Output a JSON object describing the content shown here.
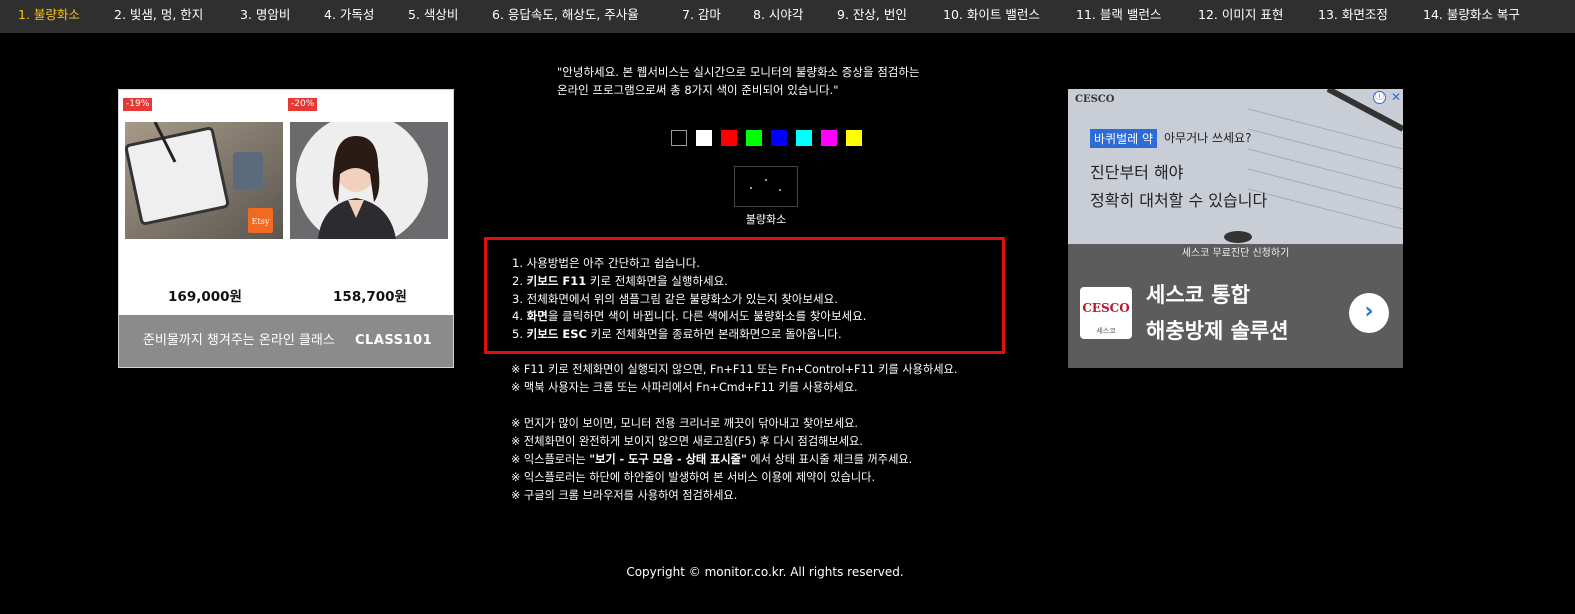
{
  "nav": {
    "items": [
      {
        "label": "1. 불량화소",
        "active": true
      },
      {
        "label": "2. 빛샘, 멍, 한지",
        "active": false
      },
      {
        "label": "3. 명암비",
        "active": false
      },
      {
        "label": "4. 가독성",
        "active": false
      },
      {
        "label": "5. 색상비",
        "active": false
      },
      {
        "label": "6. 응답속도, 해상도, 주사율",
        "active": false
      },
      {
        "label": "7. 감마",
        "active": false
      },
      {
        "label": "8. 시야각",
        "active": false
      },
      {
        "label": "9. 잔상, 번인",
        "active": false
      },
      {
        "label": "10. 화이트 밸런스",
        "active": false
      },
      {
        "label": "11. 블랙 밸런스",
        "active": false
      },
      {
        "label": "12. 이미지 표현",
        "active": false
      },
      {
        "label": "13. 화면조정",
        "active": false
      },
      {
        "label": "14. 불량화소 복구",
        "active": false
      }
    ],
    "active_color": "#f5c518"
  },
  "intro": {
    "line1": "\"안녕하세요. 본 웹서비스는 실시간으로 모니터의 불량화소 증상을 점검하는",
    "line2": "온라인 프로그램으로써 총 8가지 색이 준비되어 있습니다.\""
  },
  "swatches": [
    {
      "name": "black",
      "color": "#000000"
    },
    {
      "name": "white",
      "color": "#ffffff"
    },
    {
      "name": "red",
      "color": "#ff0000"
    },
    {
      "name": "green",
      "color": "#00ff00"
    },
    {
      "name": "blue",
      "color": "#0000ff"
    },
    {
      "name": "cyan",
      "color": "#00ffff"
    },
    {
      "name": "magenta",
      "color": "#ff00ff"
    },
    {
      "name": "yellow",
      "color": "#ffff00"
    }
  ],
  "preview": {
    "label": "불량화소"
  },
  "instructions": {
    "l1": "1. 사용방법은 아주 간단하고 쉽습니다.",
    "l2a": "2. ",
    "l2b": "키보드 F11",
    "l2c": " 키로 전체화면을 실행하세요.",
    "l3": "3. 전체화면에서 위의 샘플그림 같은 불량화소가 있는지 찾아보세요.",
    "l4a": "4. ",
    "l4b": "화면",
    "l4c": "을 클릭하면 색이 바뀝니다. 다른 색에서도 불량화소를 찾아보세요.",
    "l5a": "5. ",
    "l5b": "키보드 ESC",
    "l5c": " 키로 전체화면을 종료하면 본래화면으로 돌아옵니다.",
    "border_color": "#e01010"
  },
  "notes": {
    "n1": "※ F11 키로 전체화면이 실행되지 않으면, Fn+F11 또는 Fn+Control+F11 키를 사용하세요.",
    "n2": "※ 맥북 사용자는 크롬 또는 사파리에서 Fn+Cmd+F11 키를 사용하세요.",
    "n3": "※ 먼지가 많이 보이면, 모니터 전용 크리너로 깨끗이 닦아내고 찾아보세요.",
    "n4": "※ 전체화면이 완전하게 보이지 않으면 새로고침(F5) 후 다시 점검해보세요.",
    "n5a": "※ 익스플로러는 ",
    "n5b": "\"보기 - 도구 모음 - 상태 표시줄\"",
    "n5c": " 에서 상태 표시줄 체크를 꺼주세요.",
    "n6": "※ 익스플로러는 하단에 하얀줄이 발생하여 본 서비스 이용에 제약이 있습니다.",
    "n7": "※ 구글의 크롬 브라우저를 사용하여 점검하세요."
  },
  "ad_left": {
    "card1": {
      "discount": "-19%",
      "price": "169,000원",
      "tag": "Etsy"
    },
    "card2": {
      "discount": "-20%",
      "price": "158,700원"
    },
    "banner_text": "준비물까지 챙겨주는 온라인 클래스",
    "banner_brand": "CLASS101"
  },
  "ad_right": {
    "small_logo": "CESCO",
    "question_highlight": "바퀴벌레 약",
    "question_rest": "아무거나 쓰세요?",
    "line1": "진단부터 해야",
    "line2": "정확히 대처할 수 있습니다",
    "sub": "세스코 무료진단 신청하기",
    "logo": "CESCO",
    "logo_small": "세스코",
    "headline1": "세스코 통합",
    "headline2": "해충방제 솔루션",
    "info_icon": "ⓘ",
    "close_icon": "✕",
    "arrow": "›"
  },
  "copyright": "Copyright © monitor.co.kr. All rights reserved."
}
